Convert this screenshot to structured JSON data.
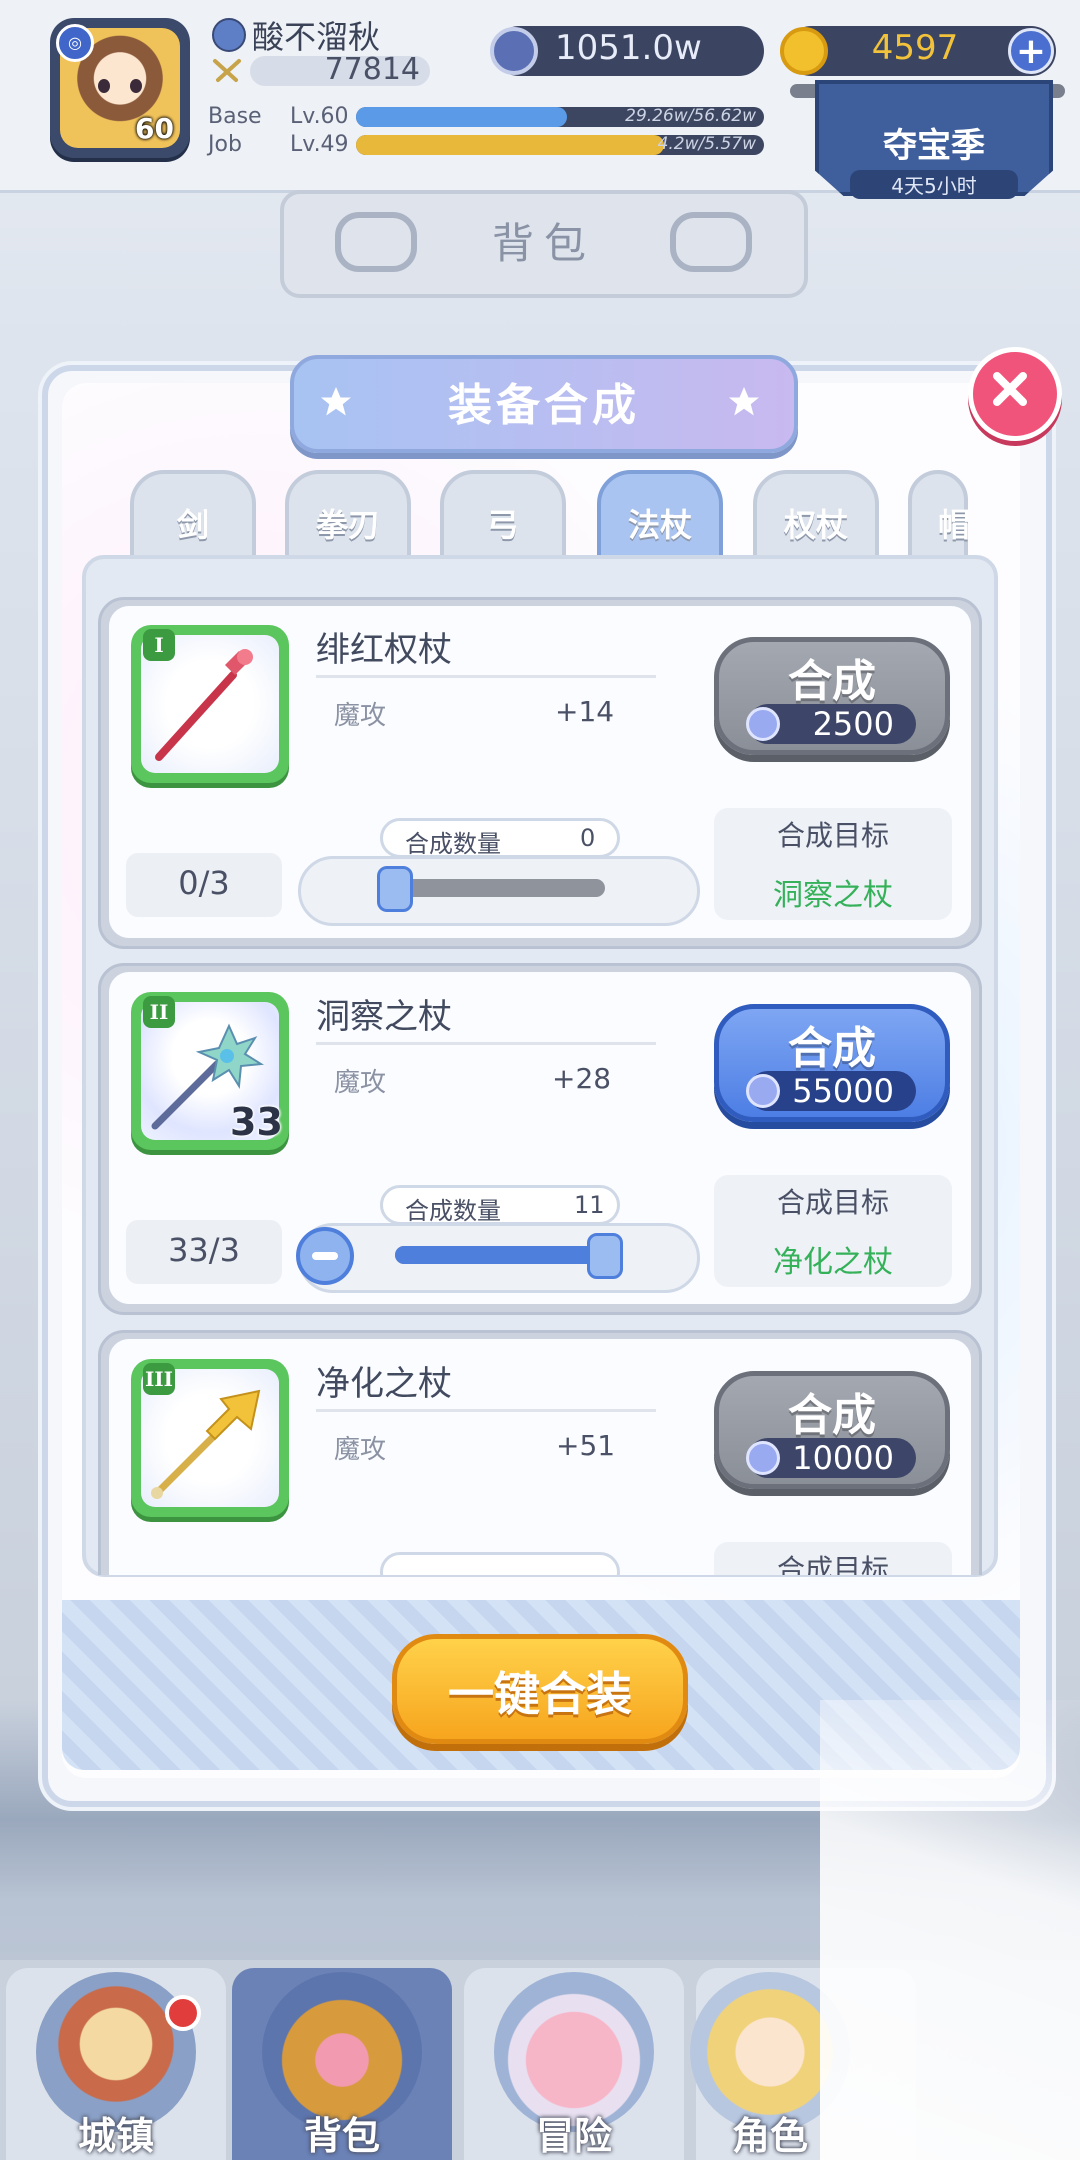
{
  "player": {
    "name": "酸不溜秋",
    "power": "77814",
    "avatar_level": "60",
    "base_label": "Base",
    "base_level": "Lv.60",
    "base_exp": "29.26w/56.62w",
    "base_progress": 0.517,
    "job_label": "Job",
    "job_level": "Lv.49",
    "job_exp": "4.2w/5.57w",
    "job_progress": 0.754
  },
  "currency": {
    "zeny": "1051.0w",
    "gold": "4597",
    "add_label": "+"
  },
  "event_banner": {
    "title": "夺宝季",
    "timer": "4天5小时"
  },
  "background_title": "背包",
  "modal": {
    "title": "装备合成",
    "tabs": [
      "剑",
      "拳刃",
      "弓",
      "法杖",
      "权杖",
      "帽"
    ],
    "active_tab": "法杖",
    "items": [
      {
        "tier": "I",
        "name": "绯红权杖",
        "stat_label": "魔攻",
        "stat_value": "+14",
        "owned": "0/3",
        "qty_label": "合成数量",
        "qty_value": "0",
        "slider_fraction": 0.0,
        "button_label": "合成",
        "cost": "2500",
        "enabled": false,
        "target_title": "合成目标",
        "target_name": "洞察之杖"
      },
      {
        "tier": "II",
        "name": "洞察之杖",
        "stat_label": "魔攻",
        "stat_value": "+28",
        "count": "33",
        "owned": "33/3",
        "qty_label": "合成数量",
        "qty_value": "11",
        "slider_fraction": 1.0,
        "button_label": "合成",
        "cost": "55000",
        "enabled": true,
        "target_title": "合成目标",
        "target_name": "净化之杖"
      },
      {
        "tier": "III",
        "name": "净化之杖",
        "stat_label": "魔攻",
        "stat_value": "+51",
        "button_label": "合成",
        "cost": "10000",
        "enabled": false,
        "target_title": "合成目标"
      }
    ],
    "one_click_label": "一键合装"
  },
  "bottom_nav": [
    {
      "label": "城镇",
      "icon": "castle-icon"
    },
    {
      "label": "背包",
      "icon": "backpack-icon"
    },
    {
      "label": "冒险",
      "icon": "poring-icon"
    },
    {
      "label": "角色",
      "icon": "character-icon"
    }
  ],
  "colors": {
    "accent_blue": "#4f7fdc",
    "target_green": "#35b15a",
    "oneclick_orange": "#f7a51e",
    "close_red": "#f1547a"
  }
}
